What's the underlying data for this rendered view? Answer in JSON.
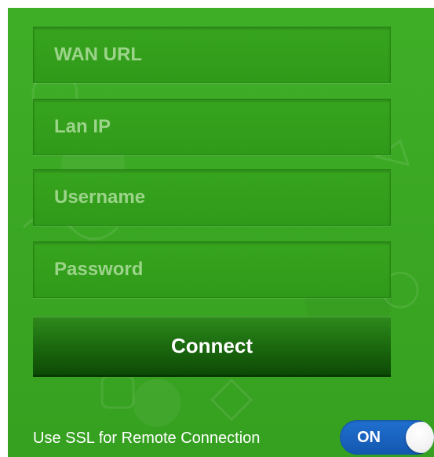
{
  "form": {
    "wan_url": {
      "placeholder": "WAN URL",
      "value": ""
    },
    "lan_ip": {
      "placeholder": "Lan IP",
      "value": ""
    },
    "username": {
      "placeholder": "Username",
      "value": ""
    },
    "password": {
      "placeholder": "Password",
      "value": ""
    },
    "connect_label": "Connect"
  },
  "ssl": {
    "label": "Use SSL for Remote Connection",
    "toggle_text": "ON",
    "enabled": true
  },
  "colors": {
    "background": "#3aa623",
    "field": "#34a01c",
    "button": "#1d6d10",
    "toggle_on": "#1a66c4",
    "text": "#ffffff"
  }
}
